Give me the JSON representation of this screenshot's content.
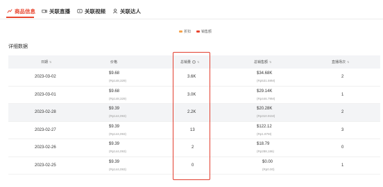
{
  "tabs": [
    {
      "label": "商品信息",
      "icon": "chart-icon",
      "active": true
    },
    {
      "label": "关联直播",
      "icon": "live-camera-icon",
      "active": false
    },
    {
      "label": "关联视频",
      "icon": "video-play-icon",
      "active": false
    },
    {
      "label": "关联达人",
      "icon": "person-icon",
      "active": false
    }
  ],
  "legend": [
    {
      "label": "折扣",
      "color": "#f5a24b"
    },
    {
      "label": "销售额",
      "color": "#e8452f"
    }
  ],
  "section_title": "详细数据",
  "columns": {
    "date": "日期",
    "price": "价格",
    "sales": "总销量",
    "gmv": "总销售额",
    "streams": "直播场次"
  },
  "rows": [
    {
      "date": "2023-03-02",
      "price": "$9.68",
      "price_sub": "(Rp148,329)",
      "sales": "3.6K",
      "gmv": "$34.68K",
      "gmv_sub": "(Rp531.59M)",
      "streams": "2"
    },
    {
      "date": "2023-03-01",
      "price": "$9.68",
      "price_sub": "(Rp148,329)",
      "sales": "3.0K",
      "gmv": "$29.14K",
      "gmv_sub": "(Rp446.79M)",
      "streams": "1"
    },
    {
      "date": "2023-02-28",
      "price": "$9.39",
      "price_sub": "(Rp144,093)",
      "sales": "2.2K",
      "gmv": "$20.28K",
      "gmv_sub": "(Rp310.91M)",
      "streams": "2"
    },
    {
      "date": "2023-02-27",
      "price": "$9.39",
      "price_sub": "(Rp144,093)",
      "sales": "13",
      "gmv": "$122.12",
      "gmv_sub": "(Rp1.87M)",
      "streams": "3"
    },
    {
      "date": "2023-02-26",
      "price": "$9.39",
      "price_sub": "(Rp144,093)",
      "sales": "2",
      "gmv": "$18.79",
      "gmv_sub": "(Rp288,186)",
      "streams": "0"
    },
    {
      "date": "2023-02-25",
      "price": "$9.39",
      "price_sub": "(Rp144,093)",
      "sales": "0",
      "gmv": "$0.00",
      "gmv_sub": "(Rp0.00)",
      "streams": "1"
    }
  ]
}
